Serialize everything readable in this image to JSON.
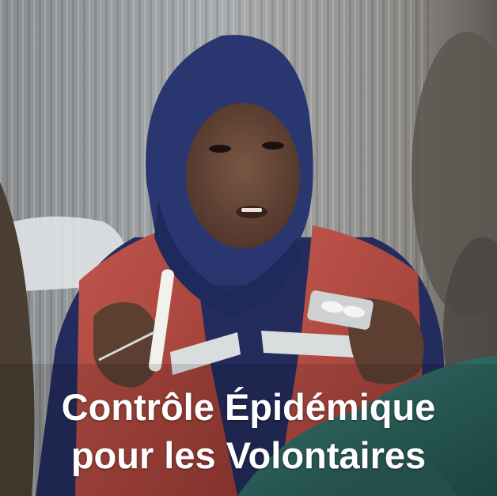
{
  "caption": {
    "line1": "Contrôle Épidémique",
    "line2": "pour les Volontaires"
  },
  "colors": {
    "hijab": "#27336a",
    "vest": "#b4483f",
    "reflective_stripe": "#d9dcdc",
    "skin": "#6b4a3a",
    "caption_text": "#ffffff"
  }
}
